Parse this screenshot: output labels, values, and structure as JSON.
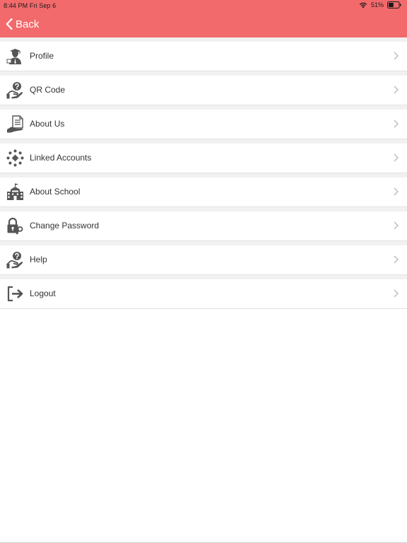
{
  "status_bar": {
    "time_date": "8:44 PM   Fri Sep 6",
    "battery_percent": "51%",
    "battery_level": 0.51
  },
  "header": {
    "back_label": "Back",
    "background_color": "#f26a6c"
  },
  "menu": {
    "items": [
      {
        "label": "Profile",
        "icon": "graduate-user-icon"
      },
      {
        "label": "QR Code",
        "icon": "question-hand-icon"
      },
      {
        "label": "About Us",
        "icon": "document-hand-icon"
      },
      {
        "label": "Linked Accounts",
        "icon": "network-dots-icon"
      },
      {
        "label": "About School",
        "icon": "school-building-icon"
      },
      {
        "label": "Change Password",
        "icon": "lock-key-icon"
      },
      {
        "label": "Help",
        "icon": "question-hand-icon"
      },
      {
        "label": "Logout",
        "icon": "logout-icon"
      }
    ]
  }
}
